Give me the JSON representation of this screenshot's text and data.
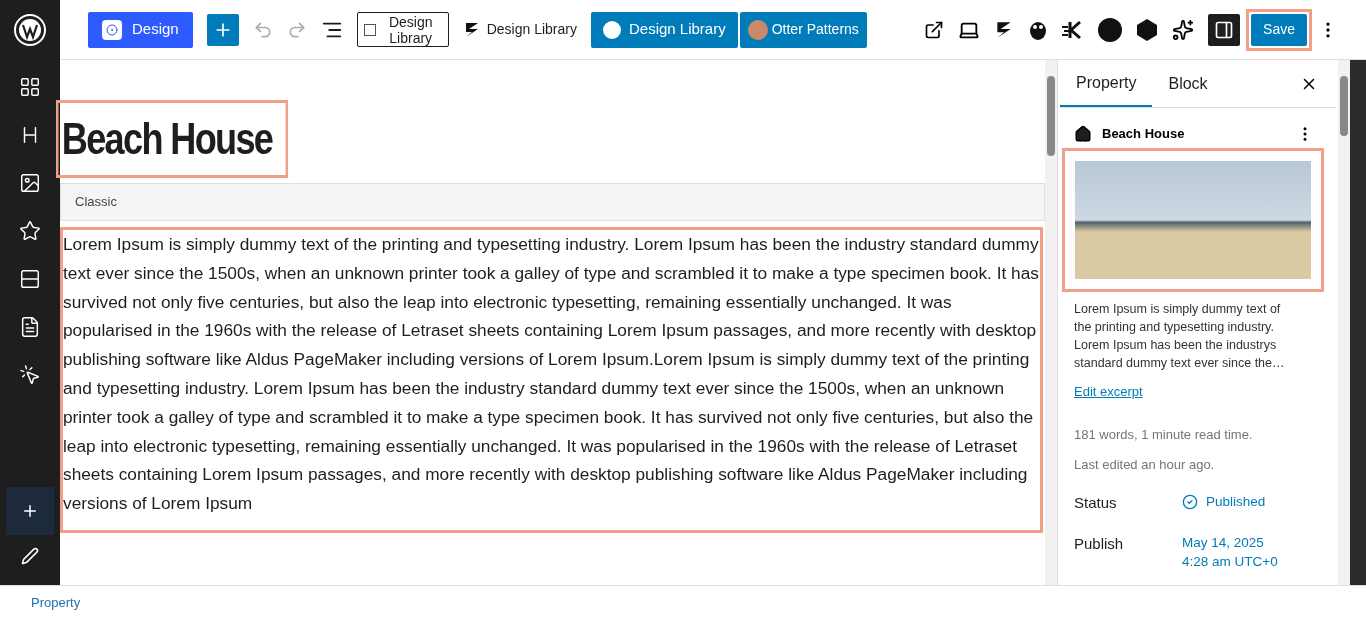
{
  "toolbar": {
    "design_button": "Design",
    "undo_disabled": true,
    "redo_disabled": true,
    "design_library_boxed": "Design Library",
    "design_library_plain": "Design Library",
    "design_library_blue": "Design Library",
    "otter_patterns": "Otter Patterns",
    "sidebar_toggle_on": true,
    "save_button": "Save"
  },
  "side_tools": [
    {
      "kind": "patterns"
    },
    {
      "kind": "heading"
    },
    {
      "kind": "image"
    },
    {
      "kind": "star"
    },
    {
      "kind": "rows"
    },
    {
      "kind": "card"
    },
    {
      "kind": "cursor"
    }
  ],
  "editor": {
    "title": "Beach House",
    "classic_label": "Classic",
    "body": "Lorem Ipsum is simply dummy text of the printing and typesetting industry. Lorem Ipsum has been the industry standard dummy text ever since the 1500s, when an unknown printer took a galley of type and scrambled it to make a type specimen book. It has survived not only five centuries, but also the leap into electronic typesetting, remaining essentially unchanged. It was popularised in the 1960s with the release of Letraset sheets containing Lorem Ipsum passages, and more recently with desktop publishing software like Aldus PageMaker including versions of Lorem Ipsum.Lorem Ipsum is simply dummy text of the printing and typesetting industry. Lorem Ipsum has been the industry standard dummy text ever since the 1500s, when an unknown printer took a galley of type and scrambled it to make a type specimen book. It has survived not only five centuries, but also the leap into electronic typesetting, remaining essentially unchanged. It was popularised in the 1960s with the release of Letraset sheets containing Lorem Ipsum passages, and more recently with desktop publishing software like Aldus PageMaker including versions of Lorem Ipsum"
  },
  "panel": {
    "tabs": [
      {
        "label": "Property",
        "selected": true
      },
      {
        "label": "Block",
        "selected": false
      }
    ],
    "post_title": "Beach House",
    "excerpt": "Lorem Ipsum is simply dummy text of the printing and typesetting industry. Lorem Ipsum has been the industrys standard dummy text ever since the…",
    "edit_excerpt": "Edit excerpt",
    "word_count": "181 words, 1 minute read time.",
    "last_edited": "Last edited an hour ago.",
    "fields": [
      {
        "label": "Status",
        "value": "Published",
        "kind": "status"
      },
      {
        "label": "Publish",
        "value": "May 14, 2025\n4:28 am UTC+0",
        "kind": "date"
      }
    ]
  },
  "footer": {
    "breadcrumb": "Property"
  }
}
